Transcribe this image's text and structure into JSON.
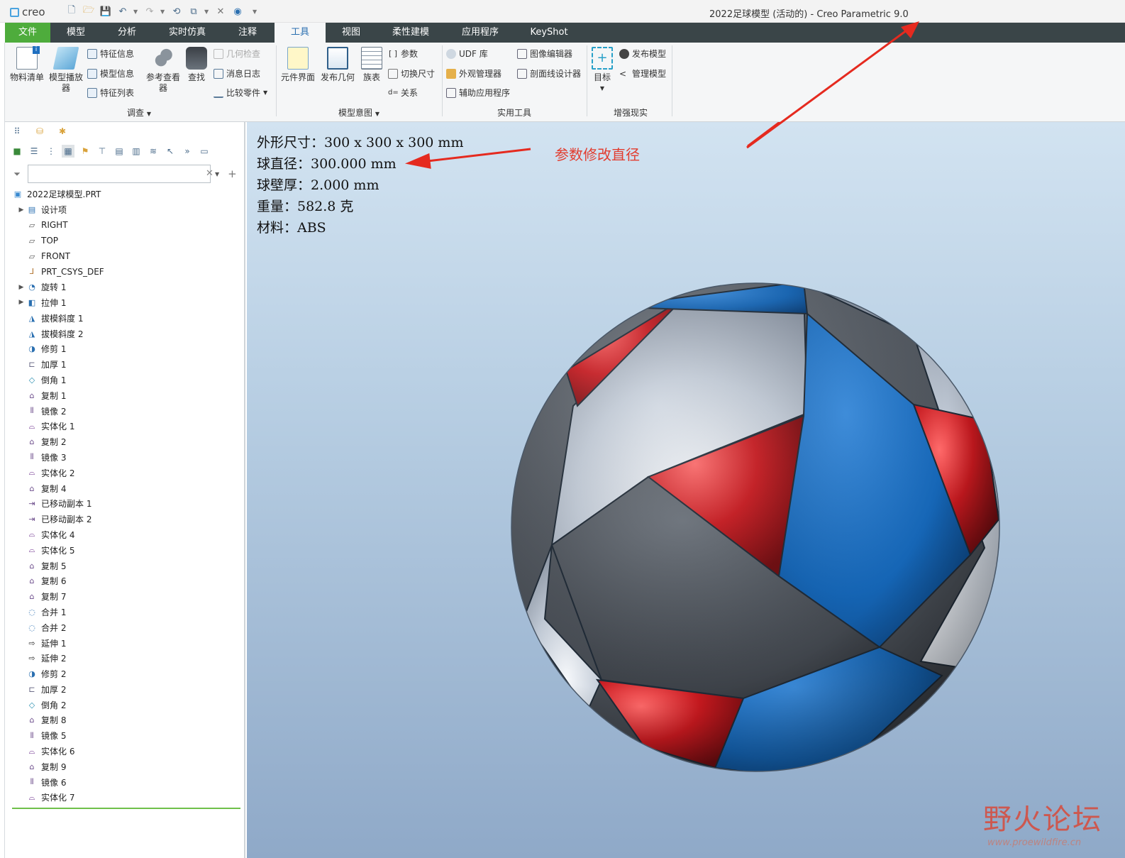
{
  "titlebar": {
    "app_name": "creo",
    "window_title": "2022足球模型 (活动的) - Creo Parametric 9.0"
  },
  "tabs": [
    {
      "label": "文件"
    },
    {
      "label": "模型"
    },
    {
      "label": "分析"
    },
    {
      "label": "实时仿真"
    },
    {
      "label": "注释"
    },
    {
      "label": "工具"
    },
    {
      "label": "视图"
    },
    {
      "label": "柔性建模"
    },
    {
      "label": "应用程序"
    },
    {
      "label": "KeyShot"
    }
  ],
  "ribbon": {
    "investigate": {
      "bom": "物料清单",
      "model_player_1": "模型播放",
      "model_player_2": "器",
      "feature_info": "特征信息",
      "model_info": "模型信息",
      "feature_list": "特征列表",
      "ref_viewer_1": "参考查看",
      "ref_viewer_2": "器",
      "find": "查找",
      "geom_check": "几何检查",
      "message_log": "消息日志",
      "compare_part": "比较零件",
      "group_label": "调查"
    },
    "model_intent": {
      "component_interface": "元件界面",
      "publish_geometry": "发布几何",
      "family_table": "族表",
      "parameters": "参数",
      "switch_dims": "切换尺寸",
      "relations": "关系",
      "group_label": "模型意图"
    },
    "utilities": {
      "udf_library": "UDF 库",
      "appearance_manager": "外观管理器",
      "auxiliary_apps": "辅助应用程序",
      "image_editor": "图像编辑器",
      "xsec_designer": "剖面线设计器",
      "group_label": "实用工具"
    },
    "ar": {
      "target": "目标",
      "publish_model": "发布模型",
      "manage_model": "管理模型",
      "group_label": "增强现实"
    }
  },
  "search": {
    "value": "",
    "placeholder": ""
  },
  "tree": [
    {
      "label": "2022足球模型.PRT",
      "icon": "part-icon",
      "expand": false,
      "indent": 0
    },
    {
      "label": "设计项",
      "icon": "design-items-icon",
      "expand": true,
      "indent": 1
    },
    {
      "label": "RIGHT",
      "icon": "datum-plane-icon",
      "expand": false,
      "indent": 1
    },
    {
      "label": "TOP",
      "icon": "datum-plane-icon",
      "expand": false,
      "indent": 1
    },
    {
      "label": "FRONT",
      "icon": "datum-plane-icon",
      "expand": false,
      "indent": 1
    },
    {
      "label": "PRT_CSYS_DEF",
      "icon": "csys-icon",
      "expand": false,
      "indent": 1
    },
    {
      "label": "旋转 1",
      "icon": "revolve-icon",
      "expand": true,
      "indent": 1
    },
    {
      "label": "拉伸 1",
      "icon": "extrude-icon",
      "expand": true,
      "indent": 1
    },
    {
      "label": "拔模斜度 1",
      "icon": "draft-icon",
      "expand": false,
      "indent": 1
    },
    {
      "label": "拔模斜度 2",
      "icon": "draft-icon",
      "expand": false,
      "indent": 1
    },
    {
      "label": "修剪 1",
      "icon": "trim-icon",
      "expand": false,
      "indent": 1
    },
    {
      "label": "加厚 1",
      "icon": "thicken-icon",
      "expand": false,
      "indent": 1
    },
    {
      "label": "倒角 1",
      "icon": "chamfer-icon",
      "expand": false,
      "indent": 1
    },
    {
      "label": "复制 1",
      "icon": "copy-icon",
      "expand": false,
      "indent": 1
    },
    {
      "label": "镜像 2",
      "icon": "mirror-icon",
      "expand": false,
      "indent": 1
    },
    {
      "label": "实体化 1",
      "icon": "solidify-icon",
      "expand": false,
      "indent": 1
    },
    {
      "label": "复制 2",
      "icon": "copy-icon",
      "expand": false,
      "indent": 1
    },
    {
      "label": "镜像 3",
      "icon": "mirror-icon",
      "expand": false,
      "indent": 1
    },
    {
      "label": "实体化 2",
      "icon": "solidify-icon",
      "expand": false,
      "indent": 1
    },
    {
      "label": "复制 4",
      "icon": "copy-icon",
      "expand": false,
      "indent": 1
    },
    {
      "label": "已移动副本 1",
      "icon": "moved-copy-icon",
      "expand": false,
      "indent": 1
    },
    {
      "label": "已移动副本 2",
      "icon": "moved-copy-icon",
      "expand": false,
      "indent": 1
    },
    {
      "label": "实体化 4",
      "icon": "solidify-icon",
      "expand": false,
      "indent": 1
    },
    {
      "label": "实体化 5",
      "icon": "solidify-icon",
      "expand": false,
      "indent": 1
    },
    {
      "label": "复制 5",
      "icon": "copy-icon",
      "expand": false,
      "indent": 1
    },
    {
      "label": "复制 6",
      "icon": "copy-icon",
      "expand": false,
      "indent": 1
    },
    {
      "label": "复制 7",
      "icon": "copy-icon",
      "expand": false,
      "indent": 1
    },
    {
      "label": "合并 1",
      "icon": "merge-icon",
      "expand": false,
      "indent": 1
    },
    {
      "label": "合并 2",
      "icon": "merge-icon",
      "expand": false,
      "indent": 1
    },
    {
      "label": "延伸 1",
      "icon": "extend-icon",
      "expand": false,
      "indent": 1
    },
    {
      "label": "延伸 2",
      "icon": "extend-icon",
      "expand": false,
      "indent": 1
    },
    {
      "label": "修剪 2",
      "icon": "trim-icon",
      "expand": false,
      "indent": 1
    },
    {
      "label": "加厚 2",
      "icon": "thicken-icon",
      "expand": false,
      "indent": 1
    },
    {
      "label": "倒角 2",
      "icon": "chamfer-icon",
      "expand": false,
      "indent": 1
    },
    {
      "label": "复制 8",
      "icon": "copy-icon",
      "expand": false,
      "indent": 1
    },
    {
      "label": "镜像 5",
      "icon": "mirror-icon",
      "expand": false,
      "indent": 1
    },
    {
      "label": "实体化 6",
      "icon": "solidify-icon",
      "expand": false,
      "indent": 1
    },
    {
      "label": "复制 9",
      "icon": "copy-icon",
      "expand": false,
      "indent": 1
    },
    {
      "label": "镜像 6",
      "icon": "mirror-icon",
      "expand": false,
      "indent": 1
    },
    {
      "label": "实体化 7",
      "icon": "solidify-icon",
      "expand": false,
      "indent": 1
    }
  ],
  "graphics": {
    "info_lines": [
      "外形尺寸：300 x 300 x 300 mm",
      "球直径：300.000 mm",
      "球壁厚：2.000 mm",
      "重量：582.8 克",
      "材料：ABS"
    ],
    "annotation": "参数修改直径",
    "watermark_main": "野火论坛",
    "watermark_url": "www.proewildfire.cn"
  },
  "colors": {
    "file_tab": "#4eac3c",
    "tab_bar": "#3a4548",
    "active_tab_text": "#2a6fb0",
    "annotation_red": "#e23d2f",
    "ball_blue": "#1565b5",
    "ball_red": "#c8191f",
    "ball_silver": "#c3ccd8",
    "ball_dark": "#50565e"
  }
}
